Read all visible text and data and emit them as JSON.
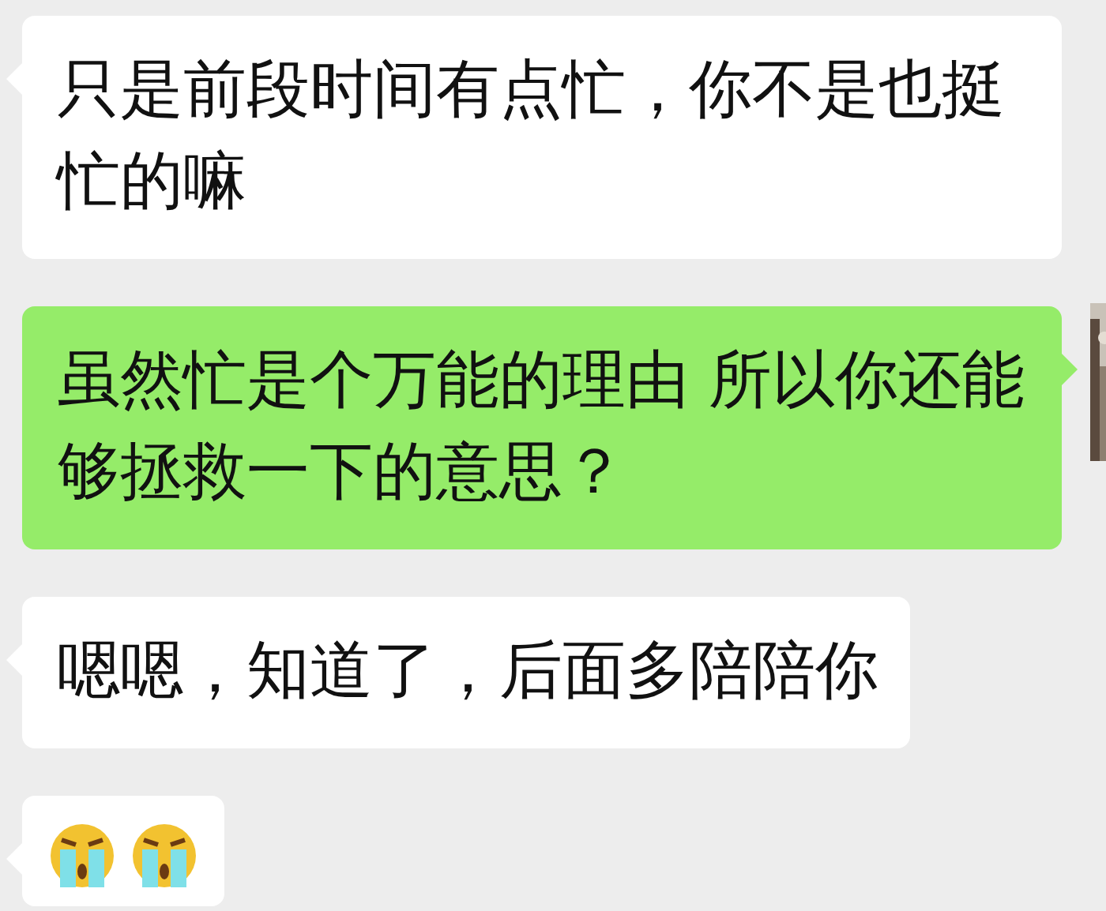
{
  "messages": [
    {
      "outgoing": false,
      "kind": "text",
      "text": "只是前段时间有点忙，你不是也挺忙的嘛"
    },
    {
      "outgoing": true,
      "kind": "text",
      "text": "虽然忙是个万能的理由 所以你还能够拯救一下的意思？"
    },
    {
      "outgoing": false,
      "kind": "text",
      "text": "嗯嗯，知道了，后面多陪陪你"
    },
    {
      "outgoing": false,
      "kind": "stickers",
      "stickers": [
        {
          "kind": "crying"
        },
        {
          "kind": "crying"
        }
      ]
    }
  ]
}
